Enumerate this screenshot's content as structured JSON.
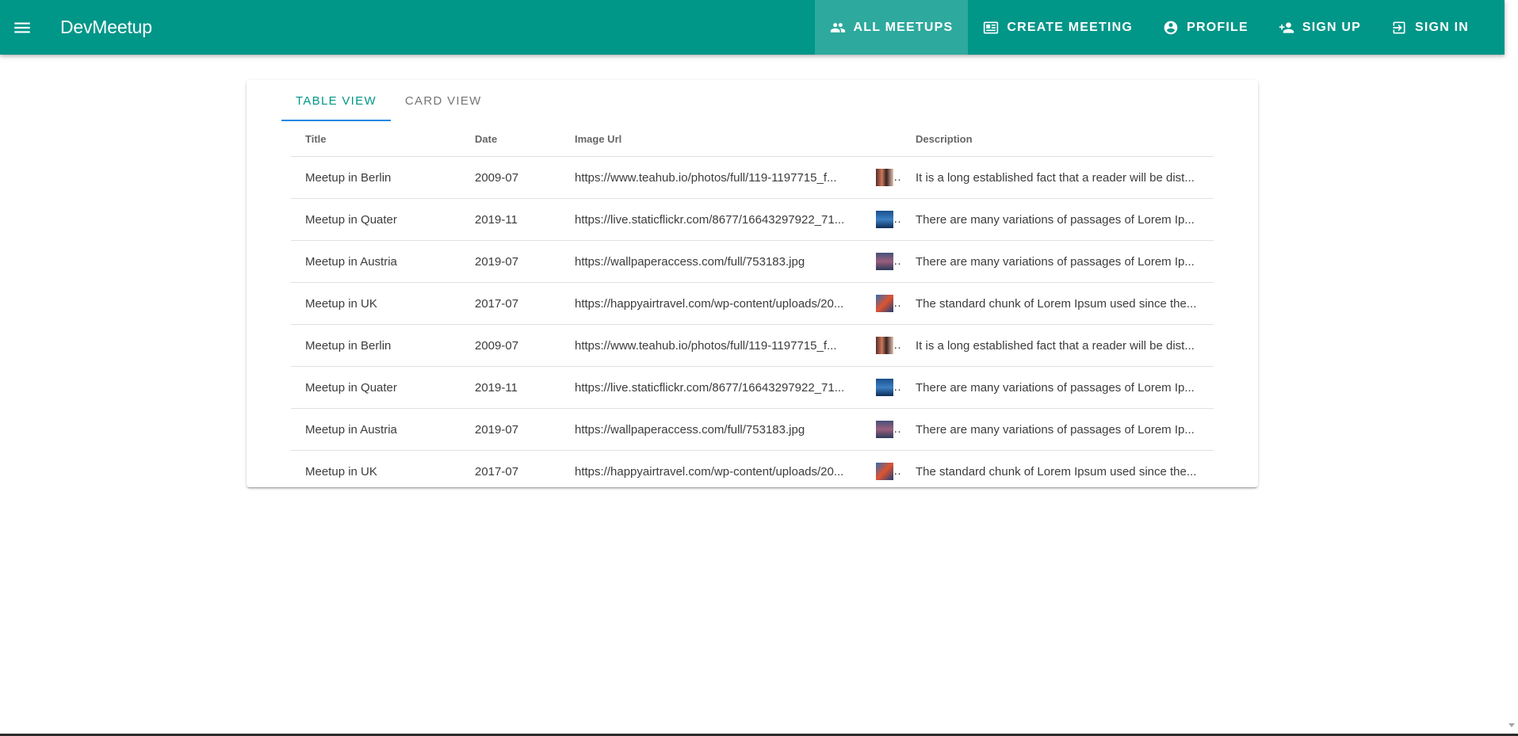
{
  "app": {
    "brand": "DevMeetup"
  },
  "nav": {
    "items": [
      {
        "label": "All Meetups",
        "icon": "group-icon",
        "active": true
      },
      {
        "label": "Create Meeting",
        "icon": "meeting-room-icon",
        "active": false
      },
      {
        "label": "Profile",
        "icon": "account-circle-icon",
        "active": false
      },
      {
        "label": "Sign Up",
        "icon": "person-add-icon",
        "active": false
      },
      {
        "label": "Sign In",
        "icon": "login-icon",
        "active": false
      }
    ]
  },
  "tabs": [
    {
      "label": "Table View",
      "active": true
    },
    {
      "label": "Card View",
      "active": false
    }
  ],
  "table": {
    "headers": {
      "title": "Title",
      "date": "Date",
      "image_url": "Image Url",
      "description": "Description"
    },
    "rows": [
      {
        "title": "Meetup in Berlin",
        "date": "2009-07",
        "image_url": "https://www.teahub.io/photos/full/119-1197715_f...",
        "description": "It is a long established fact that a reader will be dist..."
      },
      {
        "title": "Meetup in Quater",
        "date": "2019-11",
        "image_url": "https://live.staticflickr.com/8677/16643297922_71...",
        "description": "There are many variations of passages of Lorem Ip..."
      },
      {
        "title": "Meetup in Austria",
        "date": "2019-07",
        "image_url": "https://wallpaperaccess.com/full/753183.jpg",
        "description": "There are many variations of passages of Lorem Ip..."
      },
      {
        "title": "Meetup in UK",
        "date": "2017-07",
        "image_url": "https://happyairtravel.com/wp-content/uploads/20...",
        "description": "The standard chunk of Lorem Ipsum used since the..."
      },
      {
        "title": "Meetup in Berlin",
        "date": "2009-07",
        "image_url": "https://www.teahub.io/photos/full/119-1197715_f...",
        "description": "It is a long established fact that a reader will be dist..."
      },
      {
        "title": "Meetup in Quater",
        "date": "2019-11",
        "image_url": "https://live.staticflickr.com/8677/16643297922_71...",
        "description": "There are many variations of passages of Lorem Ip..."
      },
      {
        "title": "Meetup in Austria",
        "date": "2019-07",
        "image_url": "https://wallpaperaccess.com/full/753183.jpg",
        "description": "There are many variations of passages of Lorem Ip..."
      },
      {
        "title": "Meetup in UK",
        "date": "2017-07",
        "image_url": "https://happyairtravel.com/wp-content/uploads/20...",
        "description": "The standard chunk of Lorem Ipsum used since the..."
      }
    ]
  },
  "colors": {
    "primary": "#009688",
    "tab_indicator": "#1e88e5"
  }
}
